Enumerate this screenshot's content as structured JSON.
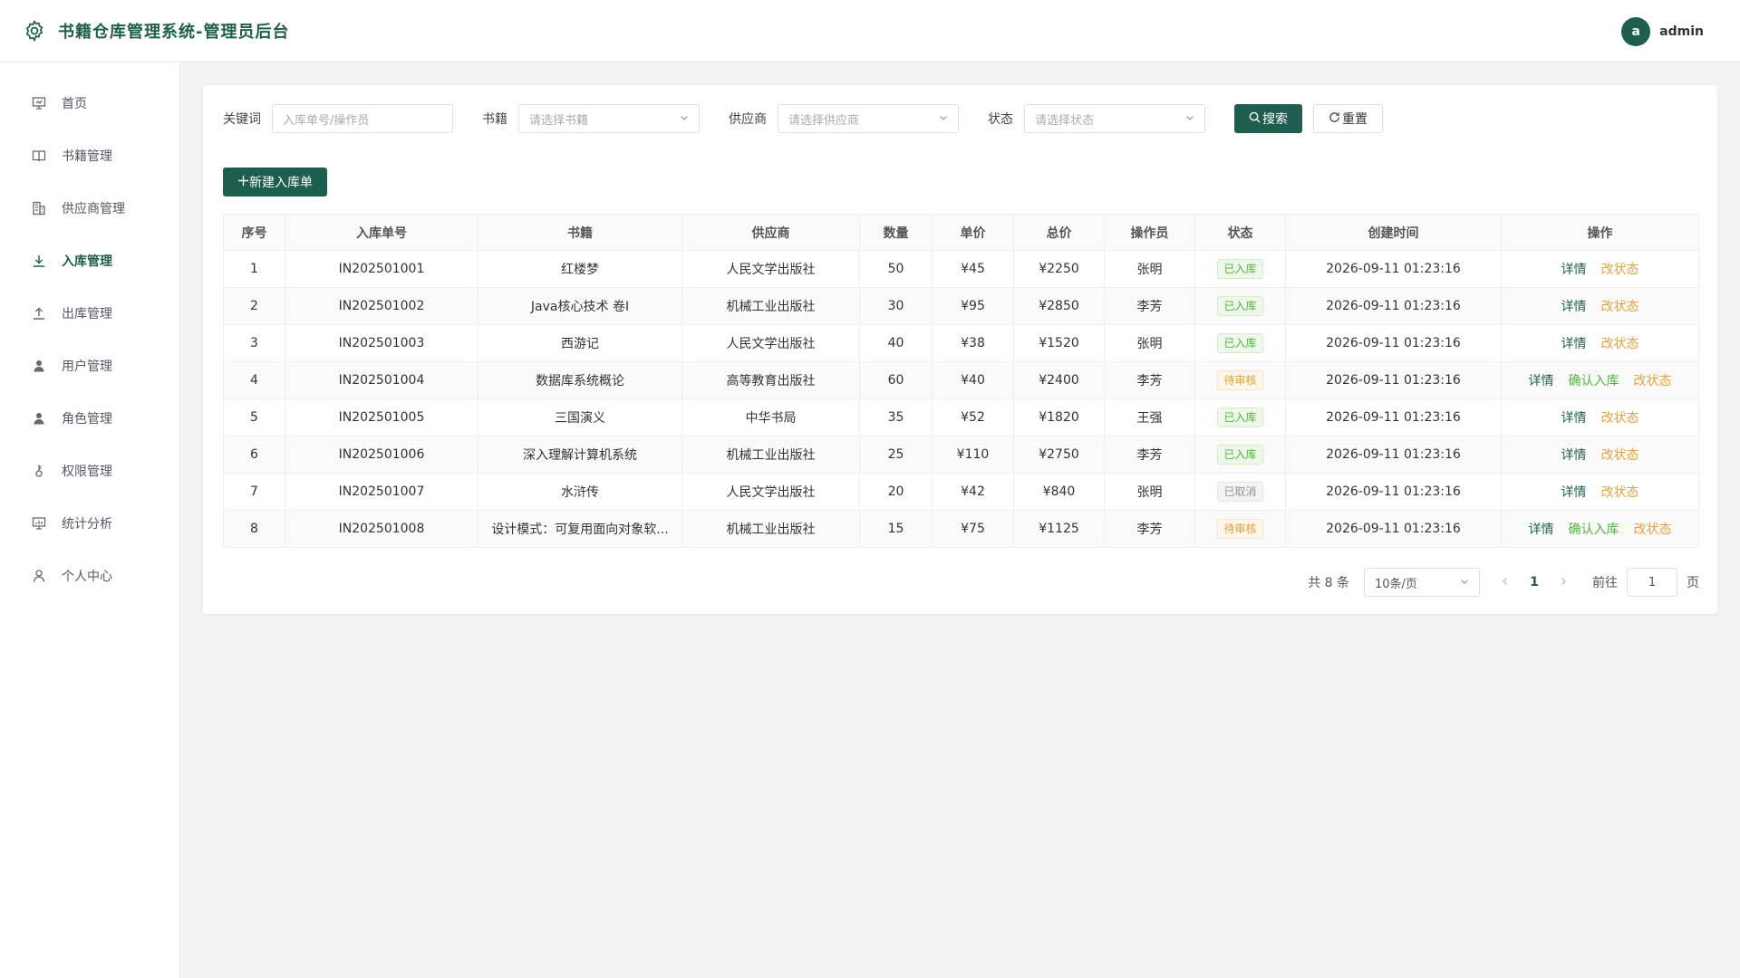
{
  "header": {
    "title": "书籍仓库管理系统-管理员后台",
    "avatar_letter": "a",
    "username": "admin"
  },
  "sidebar": {
    "items": [
      {
        "label": "首页",
        "icon": "presentation-icon"
      },
      {
        "label": "书籍管理",
        "icon": "book-icon"
      },
      {
        "label": "供应商管理",
        "icon": "building-icon"
      },
      {
        "label": "入库管理",
        "icon": "download-icon"
      },
      {
        "label": "出库管理",
        "icon": "upload-icon"
      },
      {
        "label": "用户管理",
        "icon": "user-filled-icon"
      },
      {
        "label": "角色管理",
        "icon": "user-filled-icon"
      },
      {
        "label": "权限管理",
        "icon": "key-icon"
      },
      {
        "label": "统计分析",
        "icon": "chart-icon"
      },
      {
        "label": "个人中心",
        "icon": "user-icon"
      }
    ],
    "active": "入库管理"
  },
  "filters": {
    "keyword_label": "关键词",
    "keyword_placeholder": "入库单号/操作员",
    "book_label": "书籍",
    "book_placeholder": "请选择书籍",
    "supplier_label": "供应商",
    "supplier_placeholder": "请选择供应商",
    "status_label": "状态",
    "status_placeholder": "请选择状态",
    "search_label": "搜索",
    "reset_label": "重置"
  },
  "add_button_label": "新建入库单",
  "table": {
    "headers": [
      "序号",
      "入库单号",
      "书籍",
      "供应商",
      "数量",
      "单价",
      "总价",
      "操作员",
      "状态",
      "创建时间",
      "操作"
    ],
    "rows": [
      {
        "no": "1",
        "order": "IN202501001",
        "book": "红楼梦",
        "supplier": "人民文学出版社",
        "qty": "50",
        "price": "¥45",
        "total": "¥2250",
        "operator": "张明",
        "status": "已入库",
        "created": "2026-09-11 01:23:16"
      },
      {
        "no": "2",
        "order": "IN202501002",
        "book": "Java核心技术 卷I",
        "supplier": "机械工业出版社",
        "qty": "30",
        "price": "¥95",
        "total": "¥2850",
        "operator": "李芳",
        "status": "已入库",
        "created": "2026-09-11 01:23:16"
      },
      {
        "no": "3",
        "order": "IN202501003",
        "book": "西游记",
        "supplier": "人民文学出版社",
        "qty": "40",
        "price": "¥38",
        "total": "¥1520",
        "operator": "张明",
        "status": "已入库",
        "created": "2026-09-11 01:23:16"
      },
      {
        "no": "4",
        "order": "IN202501004",
        "book": "数据库系统概论",
        "supplier": "高等教育出版社",
        "qty": "60",
        "price": "¥40",
        "total": "¥2400",
        "operator": "李芳",
        "status": "待审核",
        "created": "2026-09-11 01:23:16"
      },
      {
        "no": "5",
        "order": "IN202501005",
        "book": "三国演义",
        "supplier": "中华书局",
        "qty": "35",
        "price": "¥52",
        "total": "¥1820",
        "operator": "王强",
        "status": "已入库",
        "created": "2026-09-11 01:23:16"
      },
      {
        "no": "6",
        "order": "IN202501006",
        "book": "深入理解计算机系统",
        "supplier": "机械工业出版社",
        "qty": "25",
        "price": "¥110",
        "total": "¥2750",
        "operator": "李芳",
        "status": "已入库",
        "created": "2026-09-11 01:23:16"
      },
      {
        "no": "7",
        "order": "IN202501007",
        "book": "水浒传",
        "supplier": "人民文学出版社",
        "qty": "20",
        "price": "¥42",
        "total": "¥840",
        "operator": "张明",
        "status": "已取消",
        "created": "2026-09-11 01:23:16"
      },
      {
        "no": "8",
        "order": "IN202501008",
        "book": "设计模式：可复用面向对象软...",
        "supplier": "机械工业出版社",
        "qty": "15",
        "price": "¥75",
        "total": "¥1125",
        "operator": "李芳",
        "status": "待审核",
        "created": "2026-09-11 01:23:16"
      }
    ],
    "actions": {
      "detail": "详情",
      "confirm": "确认入库",
      "change": "改状态"
    }
  },
  "pagination": {
    "total": "共 8 条",
    "page_size": "10条/页",
    "current_page": "1",
    "goto_label": "前往",
    "goto_value": "1",
    "page_suffix": "页"
  },
  "colors": {
    "primary": "#1d5e4f",
    "success": "#52b43c",
    "warning": "#e6a23c",
    "muted": "#909399"
  }
}
